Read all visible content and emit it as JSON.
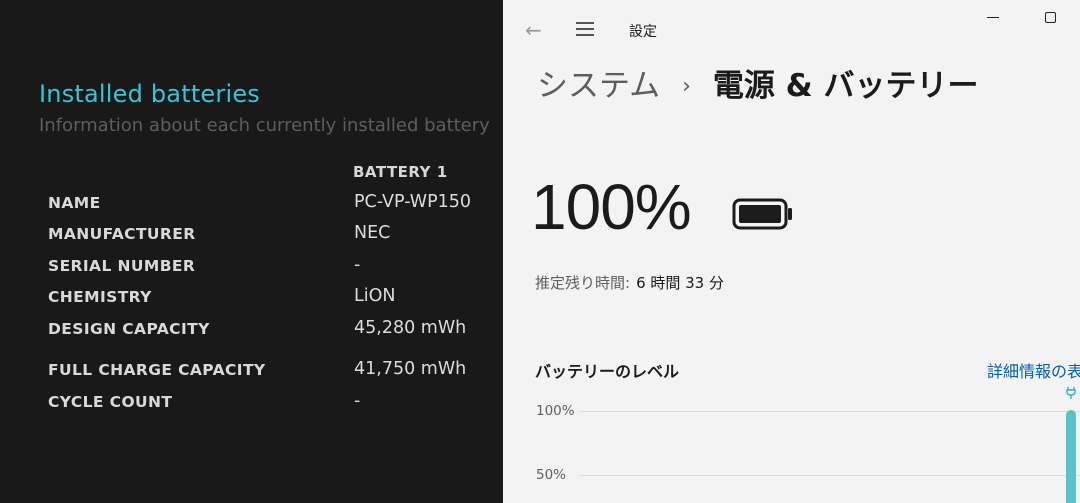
{
  "battery_report": {
    "title": "Installed batteries",
    "subtitle": "Information about each currently installed battery",
    "column_header": "BATTERY 1",
    "rows": [
      {
        "label": "NAME",
        "value": "PC-VP-WP150"
      },
      {
        "label": "MANUFACTURER",
        "value": "NEC"
      },
      {
        "label": "SERIAL NUMBER",
        "value": "-"
      },
      {
        "label": "CHEMISTRY",
        "value": "LiON"
      },
      {
        "label": "DESIGN CAPACITY",
        "value": "45,280 mWh"
      },
      {
        "label": "FULL CHARGE CAPACITY",
        "value": "41,750 mWh"
      },
      {
        "label": "CYCLE COUNT",
        "value": "-"
      }
    ]
  },
  "settings": {
    "app_title": "設定",
    "breadcrumb": {
      "parent": "システム",
      "separator": "›",
      "current": "電源 & バッテリー"
    },
    "battery_percent": "100%",
    "battery_level_fraction": 1.0,
    "remaining_label": "推定残り時間:",
    "remaining_value": "6 時間 33 分",
    "level_heading": "バッテリーのレベル",
    "details_link": "詳細情報の表",
    "y_ticks": [
      "100%",
      "50%"
    ],
    "accent_color": "#59c3cc",
    "link_color": "#005fb8",
    "icons": {
      "back": "back-arrow-icon",
      "menu": "hamburger-menu-icon",
      "minimize": "minimize-icon",
      "maximize": "maximize-icon",
      "battery": "battery-full-icon",
      "plug": "plug-icon"
    }
  }
}
